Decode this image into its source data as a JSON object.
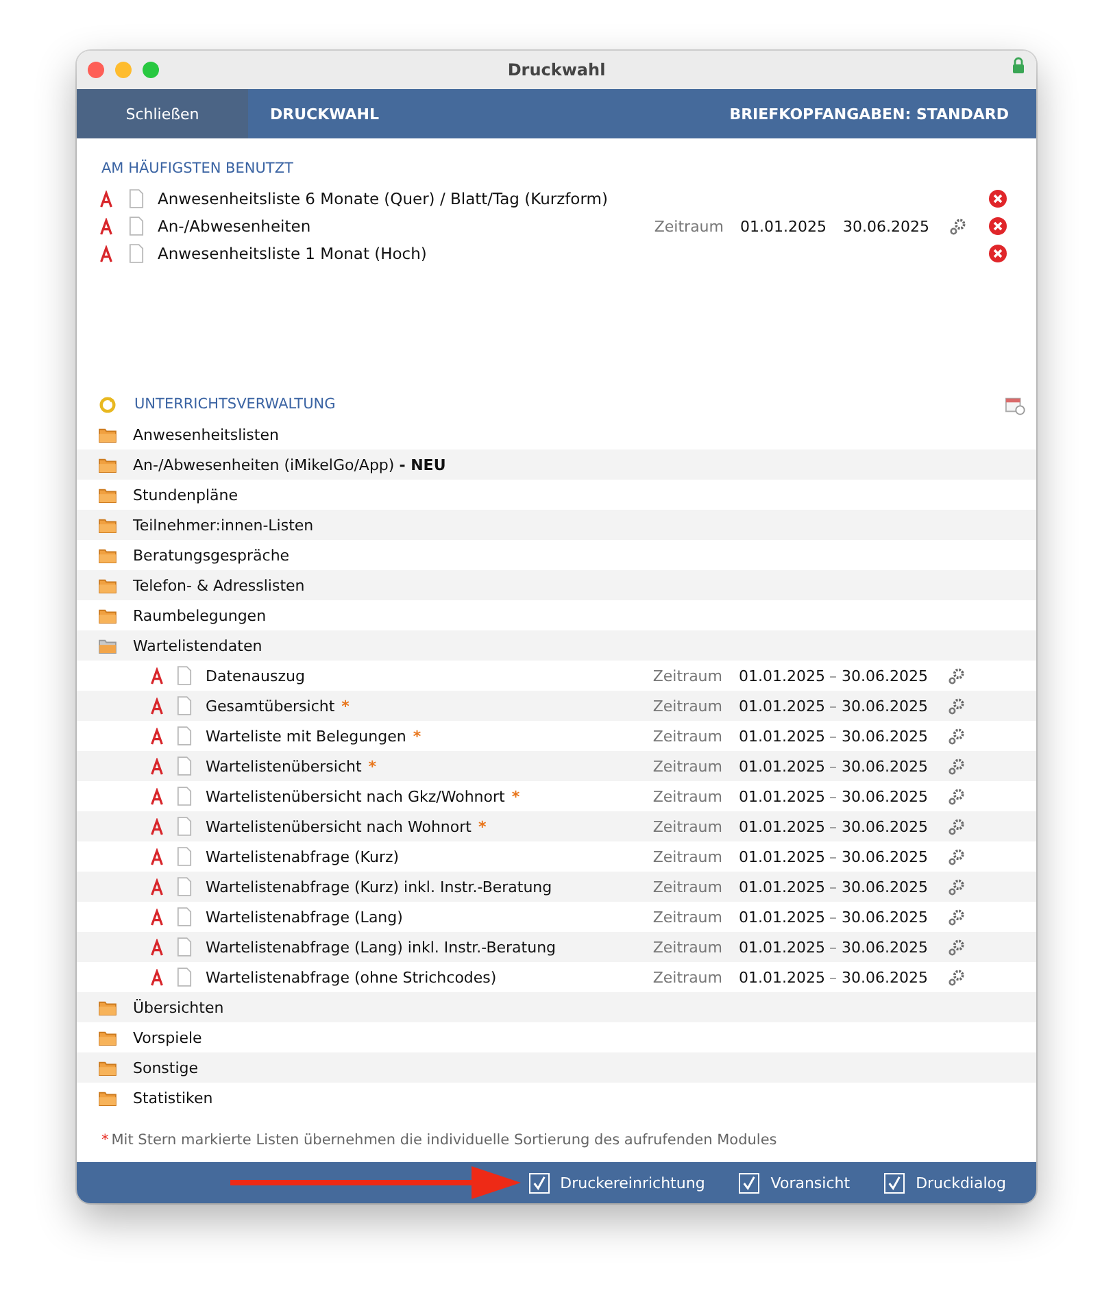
{
  "window": {
    "title": "Druckwahl"
  },
  "navbar": {
    "close_button": "Schließen",
    "title": "DRUCKWAHL",
    "letterhead": "BRIEFKOPFANGABEN: STANDARD"
  },
  "favorites": {
    "heading": "AM HÄUFIGSTEN BENUTZT",
    "items": [
      {
        "name": "Anwesenheitsliste 6 Monate (Quer) / Blatt/Tag (Kurzform)"
      },
      {
        "name": "An-/Abwesenheiten",
        "period_label": "Zeitraum",
        "from": "01.01.2025",
        "to": "30.06.2025"
      },
      {
        "name": "Anwesenheitsliste 1 Monat (Hoch)"
      }
    ]
  },
  "section": {
    "heading": "UNTERRICHTSVERWALTUNG",
    "folders": [
      {
        "name": "Anwesenheitslisten",
        "expanded": false
      },
      {
        "name": "An-/Abwesenheiten (iMikelGo/App) **- NEU**",
        "expanded": false
      },
      {
        "name": "Stundenpläne",
        "expanded": false
      },
      {
        "name": "Teilnehmer:innen-Listen",
        "expanded": false
      },
      {
        "name": "Beratungsgespräche",
        "expanded": false
      },
      {
        "name": "Telefon- & Adresslisten",
        "expanded": false
      },
      {
        "name": "Raumbelegungen",
        "expanded": false
      },
      {
        "name": "Wartelistendaten",
        "expanded": true,
        "children": [
          {
            "name": "Datenauszug",
            "period_label": "Zeitraum",
            "from": "01.01.2025",
            "separator": "–",
            "to": "30.06.2025"
          },
          {
            "name": "Gesamtübersicht",
            "star": "*",
            "period_label": "Zeitraum",
            "from": "01.01.2025",
            "separator": "–",
            "to": "30.06.2025"
          },
          {
            "name": "Warteliste mit Belegungen",
            "star": "*",
            "period_label": "Zeitraum",
            "from": "01.01.2025",
            "separator": "–",
            "to": "30.06.2025"
          },
          {
            "name": "Wartelistenübersicht",
            "star": "*",
            "period_label": "Zeitraum",
            "from": "01.01.2025",
            "separator": "–",
            "to": "30.06.2025"
          },
          {
            "name": "Wartelistenübersicht nach Gkz/Wohnort",
            "star": "*",
            "period_label": "Zeitraum",
            "from": "01.01.2025",
            "separator": "–",
            "to": "30.06.2025"
          },
          {
            "name": "Wartelistenübersicht nach Wohnort",
            "star": "*",
            "period_label": "Zeitraum",
            "from": "01.01.2025",
            "separator": "–",
            "to": "30.06.2025"
          },
          {
            "name": "Wartelistenabfrage (Kurz)",
            "period_label": "Zeitraum",
            "from": "01.01.2025",
            "separator": "–",
            "to": "30.06.2025"
          },
          {
            "name": "Wartelistenabfrage (Kurz) inkl. Instr.-Beratung",
            "period_label": "Zeitraum",
            "from": "01.01.2025",
            "separator": "–",
            "to": "30.06.2025"
          },
          {
            "name": "Wartelistenabfrage (Lang)",
            "period_label": "Zeitraum",
            "from": "01.01.2025",
            "separator": "–",
            "to": "30.06.2025"
          },
          {
            "name": "Wartelistenabfrage (Lang) inkl. Instr.-Beratung",
            "period_label": "Zeitraum",
            "from": "01.01.2025",
            "separator": "–",
            "to": "30.06.2025"
          },
          {
            "name": "Wartelistenabfrage (ohne Strichcodes)",
            "period_label": "Zeitraum",
            "from": "01.01.2025",
            "separator": "–",
            "to": "30.06.2025"
          }
        ]
      },
      {
        "name": "Übersichten",
        "expanded": false
      },
      {
        "name": "Vorspiele",
        "expanded": false
      },
      {
        "name": "Sonstige",
        "expanded": false
      },
      {
        "name": "Statistiken",
        "expanded": false
      }
    ]
  },
  "footnote": {
    "mark": "*",
    "text": "Mit Stern markierte Listen übernehmen die individuelle Sortierung des aufrufenden Modules"
  },
  "options": [
    {
      "label": "Druckereinrichtung",
      "checked": true
    },
    {
      "label": "Voransicht",
      "checked": true
    },
    {
      "label": "Druckdialog",
      "checked": true
    }
  ]
}
